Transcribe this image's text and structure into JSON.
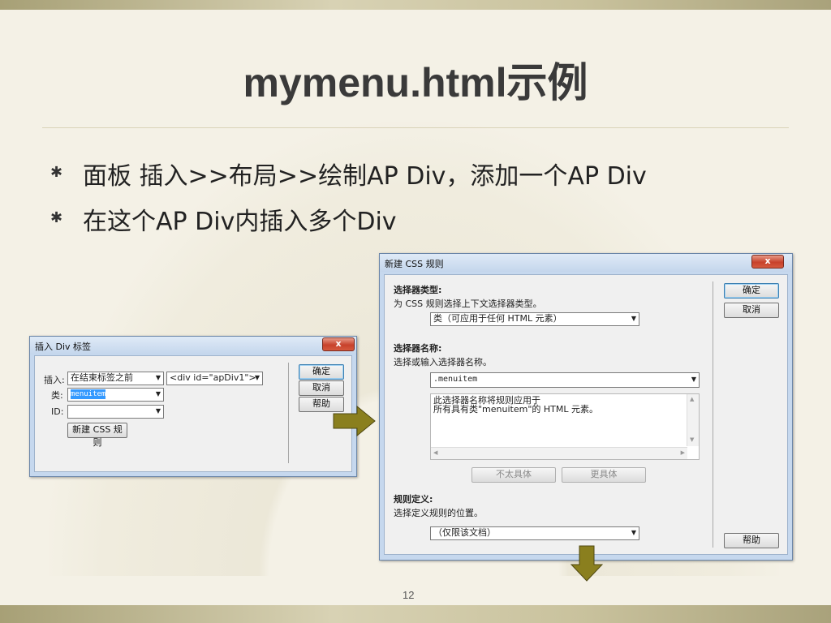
{
  "slide": {
    "title": "mymenu.html示例",
    "bullets": [
      "面板 插入>>布局>>绘制AP Div，添加一个AP Div",
      "在这个AP Div内插入多个Div"
    ],
    "page_number": "12",
    "bullet_icon": "asterisk-icon"
  },
  "insert_div_dialog": {
    "title": "插入 Div 标签",
    "close": "x",
    "insert_label": "插入:",
    "insert_value": "在结束标签之前",
    "position_value": "<div id=\"apDiv1\">",
    "class_label": "类:",
    "class_value": "menuitem",
    "id_label": "ID:",
    "id_value": "",
    "new_css_rule": "新建 CSS 规则",
    "ok": "确定",
    "cancel": "取消",
    "help": "帮助"
  },
  "new_css_dialog": {
    "title": "新建 CSS 规则",
    "close": "x",
    "selector_type_heading": "选择器类型:",
    "selector_type_desc": "为 CSS 规则选择上下文选择器类型。",
    "selector_type_value": "类（可应用于任何 HTML 元素）",
    "selector_name_heading": "选择器名称:",
    "selector_name_desc": "选择或输入选择器名称。",
    "selector_name_value": ".menuitem",
    "description_line1": "此选择器名称将规则应用于",
    "description_line2": "所有具有类\"menuitem\"的 HTML 元素。",
    "less_specific": "不太具体",
    "more_specific": "更具体",
    "rule_definition_heading": "规则定义:",
    "rule_definition_desc": "选择定义规则的位置。",
    "rule_definition_value": "（仅限该文档）",
    "ok": "确定",
    "cancel": "取消",
    "help": "帮助"
  },
  "colors": {
    "arrow": "#8a7f1e",
    "accent_bar": "#bdb58f",
    "title_text": "#3a3a3a"
  }
}
